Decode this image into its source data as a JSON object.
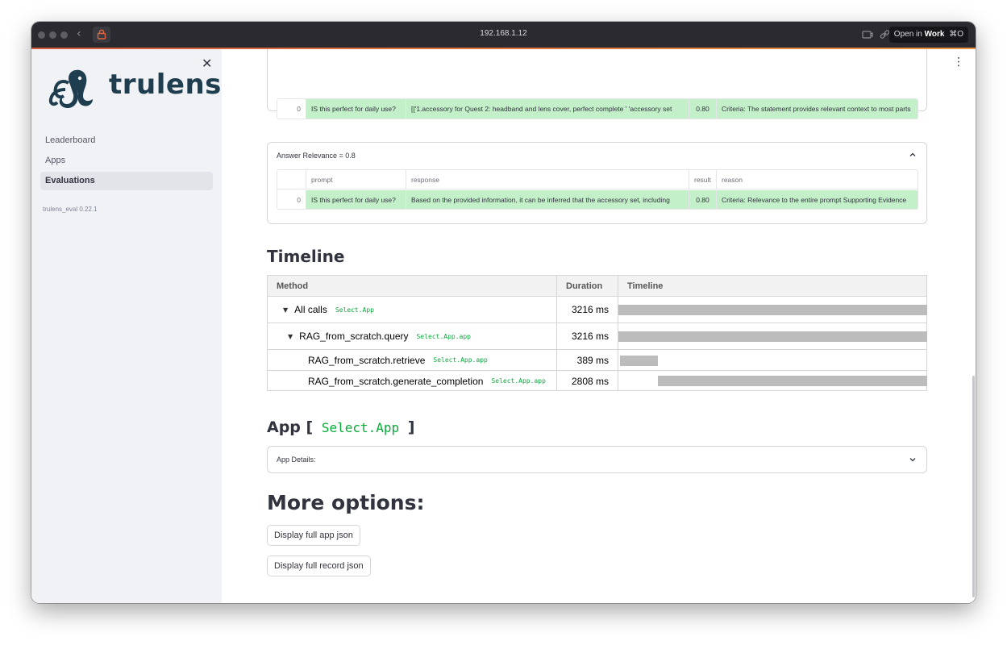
{
  "browser": {
    "url": "192.168.1.12",
    "open_in_prefix": "Open in",
    "open_in_target": "Work",
    "open_in_shortcut": "⌘O"
  },
  "sidebar": {
    "logo_text": "trulens",
    "nav": [
      "Leaderboard",
      "Apps",
      "Evaluations"
    ],
    "active": "Evaluations",
    "version": "trulens_eval 0.22.1"
  },
  "top_table": {
    "row": {
      "index": "0",
      "prompt": "IS this perfect for daily use?",
      "response": "[['1.accessory for Quest 2: headband and lens cover, perfect complete '  'accessory set",
      "result": "0.80",
      "reason": "Criteria: The statement provides relevant context to most parts"
    }
  },
  "answer_relevance": {
    "title": "Answer Relevance = 0.8",
    "columns": [
      "prompt",
      "response",
      "result",
      "reason"
    ],
    "row": {
      "index": "0",
      "prompt": "IS this perfect for daily use?",
      "response": "Based on the provided information, it can be inferred that the accessory set, including",
      "result": "0.80",
      "reason": "Criteria: Relevance to the entire prompt Supporting Evidence"
    }
  },
  "timeline": {
    "heading": "Timeline",
    "columns": [
      "Method",
      "Duration",
      "Timeline"
    ],
    "rows": [
      {
        "method": "All calls",
        "path": "Select.App",
        "duration": "3216 ms",
        "start": 0,
        "ms": 3216,
        "caret": true
      },
      {
        "method": "RAG_from_scratch.query",
        "path": "Select.App.app",
        "duration": "3216 ms",
        "start": 0,
        "ms": 3216,
        "caret": true
      },
      {
        "method": "RAG_from_scratch.retrieve",
        "path": "Select.App.app",
        "duration": "389 ms",
        "start": 19,
        "ms": 389,
        "caret": false
      },
      {
        "method": "RAG_from_scratch.generate_completion",
        "path": "Select.App.app",
        "duration": "2808 ms",
        "start": 408,
        "ms": 2808,
        "caret": false
      }
    ]
  },
  "app_section": {
    "heading_prefix": "App [",
    "heading_code": "Select.App",
    "heading_suffix": "]",
    "details_label": "App Details:"
  },
  "more_options": {
    "heading": "More options:",
    "buttons": [
      "Display full app json",
      "Display full record json"
    ]
  }
}
